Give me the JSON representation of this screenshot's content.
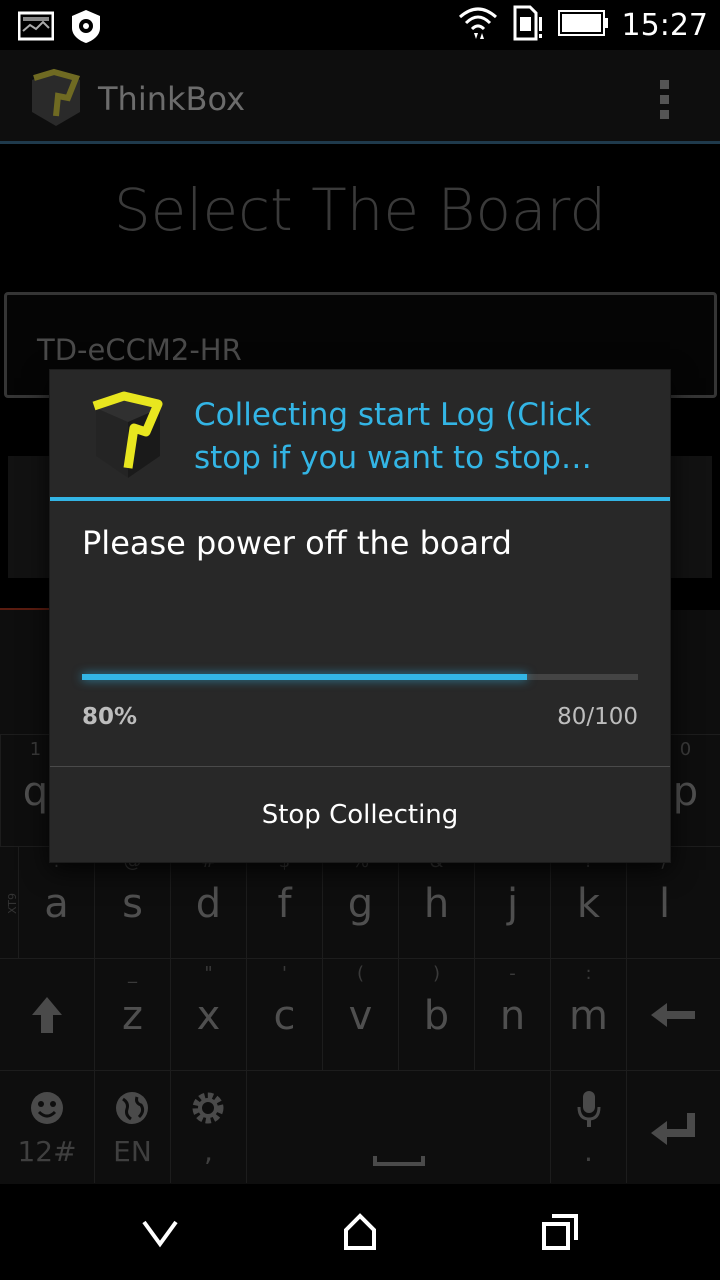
{
  "status_bar": {
    "time": "15:27",
    "icons": [
      "image-notification-icon",
      "settings-notification-icon",
      "wifi-icon",
      "sim-alert-icon",
      "battery-icon"
    ]
  },
  "app": {
    "title": "ThinkBox",
    "heading": "Select The Board",
    "board_value": "TD-eCCM2-HR"
  },
  "dialog": {
    "title": "Collecting start Log (Click stop if you want to stop…",
    "message": "Please power off the board",
    "progress": {
      "value": 80,
      "max": 100,
      "percent_label": "80%",
      "count_label": "80/100"
    },
    "button_label": "Stop Collecting",
    "accent_color": "#33b5e5"
  },
  "keyboard": {
    "row1": {
      "keys": [
        "q",
        "p"
      ],
      "alts": [
        "1",
        "0"
      ]
    },
    "row2": {
      "side_label": "XT9",
      "keys": [
        "a",
        "s",
        "d",
        "f",
        "g",
        "h",
        "j",
        "k",
        "l"
      ],
      "alts": [
        "!",
        "@",
        "#",
        "$",
        "%",
        "&",
        "*",
        "?",
        "/"
      ]
    },
    "row3": {
      "keys": [
        "z",
        "x",
        "c",
        "v",
        "b",
        "n",
        "m"
      ],
      "alts": [
        "_",
        "\"",
        "'",
        "(",
        ")",
        "-",
        ":"
      ]
    },
    "row4": {
      "symbols_label": "12#",
      "language_label": "EN",
      "settings_alt": ",",
      "mic_alt": "."
    }
  },
  "nav_bar": {
    "icons": [
      "back-icon",
      "home-icon",
      "recents-icon"
    ]
  }
}
